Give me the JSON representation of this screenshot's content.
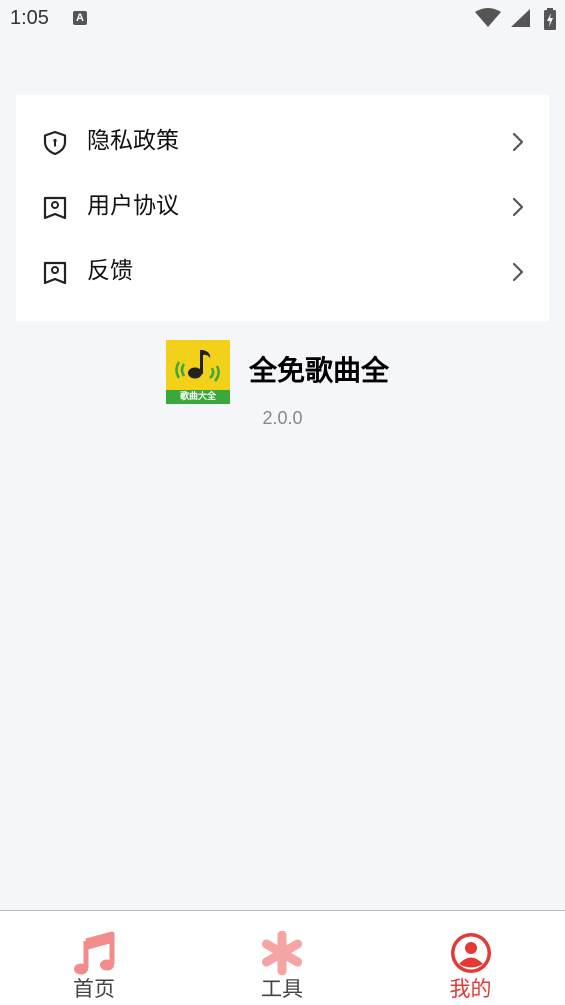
{
  "status_bar": {
    "time": "1:05",
    "notification_icon": "A"
  },
  "menu": {
    "items": [
      {
        "label": "隐私政策",
        "icon": "shield-icon"
      },
      {
        "label": "用户协议",
        "icon": "bookmark-icon"
      },
      {
        "label": "反馈",
        "icon": "bookmark-icon"
      }
    ]
  },
  "app": {
    "logo_text": "歌曲大全",
    "name": "全免歌曲全",
    "version": "2.0.0"
  },
  "bottom_nav": {
    "items": [
      {
        "label": "首页",
        "icon": "music-note-icon",
        "active": false
      },
      {
        "label": "工具",
        "icon": "asterisk-icon",
        "active": false
      },
      {
        "label": "我的",
        "icon": "user-icon",
        "active": true
      }
    ],
    "colors": {
      "active": "#e53935",
      "home_icon": "#f28b8b",
      "tools_icon": "#f5a3a3"
    }
  }
}
